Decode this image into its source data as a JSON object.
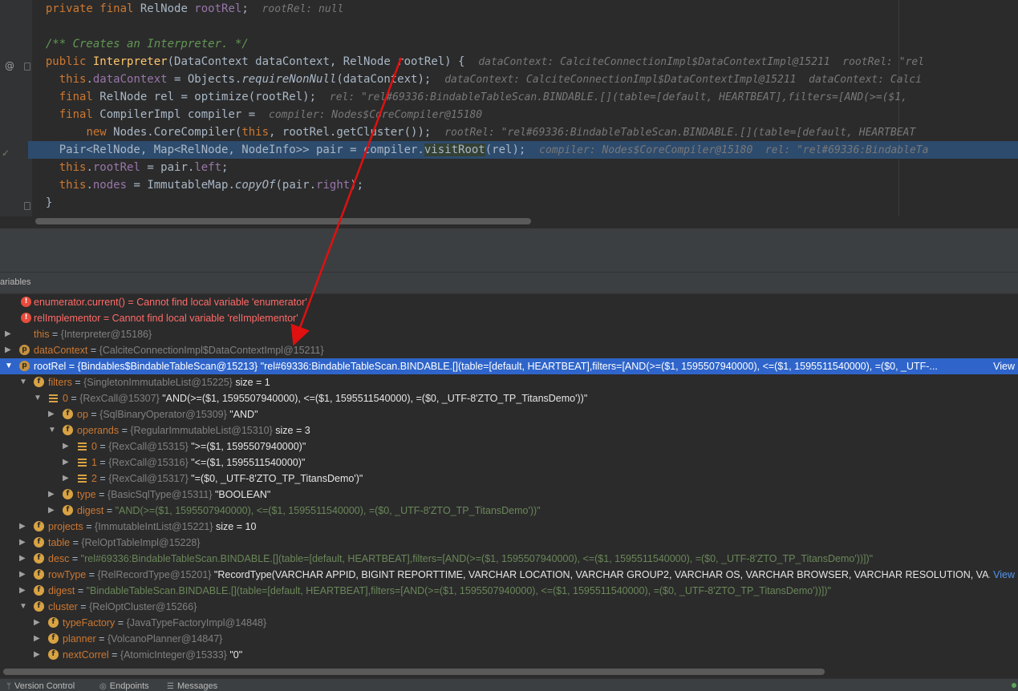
{
  "editor": {
    "lines": [
      {
        "kind": "field",
        "text": "private final RelNode rootRel;",
        "hint": "rootRel: null"
      },
      {
        "kind": "blank"
      },
      {
        "kind": "comment",
        "text": "/** Creates an Interpreter. */"
      },
      {
        "kind": "ctor",
        "hint": "dataContext: CalciteConnectionImpl$DataContextImpl@15211  rootRel: \"rel"
      },
      {
        "kind": "assign1",
        "hint": "dataContext: CalciteConnectionImpl$DataContextImpl@15211  dataContext: Calci"
      },
      {
        "kind": "assign2",
        "hint": "rel: \"rel#69336:BindableTableScan.BINDABLE.[](table=[default, HEARTBEAT],filters=[AND(>=($1,"
      },
      {
        "kind": "assign3",
        "hint": "compiler: Nodes$CoreCompiler@15180"
      },
      {
        "kind": "assign4",
        "hint": "rootRel: \"rel#69336:BindableTableScan.BINDABLE.[](table=[default, HEARTBEAT"
      },
      {
        "kind": "assign5",
        "hint": "compiler: Nodes$CoreCompiler@15180  rel: \"rel#69336:BindableTa"
      },
      {
        "kind": "assign6"
      },
      {
        "kind": "assign7"
      },
      {
        "kind": "close",
        "text": "}"
      }
    ]
  },
  "panel": {
    "variables_label": "ariables"
  },
  "tree": {
    "rows": [
      {
        "indent": 0,
        "arrow": "",
        "icon": "err",
        "name": "enumerator.current()",
        "eq": " = ",
        "error": "Cannot find local variable 'enumerator'"
      },
      {
        "indent": 0,
        "arrow": "",
        "icon": "err",
        "name": "relImplementor",
        "eq": " = ",
        "error": "Cannot find local variable 'relImplementor'"
      },
      {
        "indent": 0,
        "arrow": "right",
        "icon": "",
        "name": "this",
        "eq": " = ",
        "ref": "{Interpreter@15186}"
      },
      {
        "indent": 0,
        "arrow": "right",
        "icon": "p",
        "name": "dataContext",
        "eq": " = ",
        "ref": "{CalciteConnectionImpl$DataContextImpl@15211}"
      },
      {
        "indent": 0,
        "arrow": "down",
        "icon": "p",
        "name": "rootRel",
        "eq": " = ",
        "ref": "{Bindables$BindableTableScan@15213}",
        "val": " \"rel#69336:BindableTableScan.BINDABLE.[](table=[default, HEARTBEAT],filters=[AND(>=($1, 1595507940000), <=($1, 1595511540000), =($0, _UTF-...",
        "view": "View",
        "selected": true
      },
      {
        "indent": 1,
        "arrow": "down",
        "icon": "f",
        "name": "filters",
        "eq": " = ",
        "ref": "{SingletonImmutableList@15225}",
        "val": "  size = 1"
      },
      {
        "indent": 2,
        "arrow": "down",
        "icon": "arr",
        "name": "0",
        "eq": " = ",
        "ref": "{RexCall@15307}",
        "val": " \"AND(>=($1, 1595507940000), <=($1, 1595511540000), =($0, _UTF-8'ZTO_TP_TitansDemo'))\""
      },
      {
        "indent": 3,
        "arrow": "right",
        "icon": "f",
        "name": "op",
        "eq": " = ",
        "ref": "{SqlBinaryOperator@15309}",
        "val": " \"AND\""
      },
      {
        "indent": 3,
        "arrow": "down",
        "icon": "f",
        "name": "operands",
        "eq": " = ",
        "ref": "{RegularImmutableList@15310}",
        "val": "  size = 3"
      },
      {
        "indent": 4,
        "arrow": "right",
        "icon": "arr",
        "name": "0",
        "eq": " = ",
        "ref": "{RexCall@15315}",
        "val": " \">=($1, 1595507940000)\""
      },
      {
        "indent": 4,
        "arrow": "right",
        "icon": "arr",
        "name": "1",
        "eq": " = ",
        "ref": "{RexCall@15316}",
        "val": " \"<=($1, 1595511540000)\""
      },
      {
        "indent": 4,
        "arrow": "right",
        "icon": "arr",
        "name": "2",
        "eq": " = ",
        "ref": "{RexCall@15317}",
        "val": " \"=($0, _UTF-8'ZTO_TP_TitansDemo')\""
      },
      {
        "indent": 3,
        "arrow": "right",
        "icon": "f",
        "name": "type",
        "eq": " = ",
        "ref": "{BasicSqlType@15311}",
        "val": " \"BOOLEAN\""
      },
      {
        "indent": 3,
        "arrow": "right",
        "icon": "f",
        "name": "digest",
        "eq": " = ",
        "str": "\"AND(>=($1, 1595507940000), <=($1, 1595511540000), =($0, _UTF-8'ZTO_TP_TitansDemo'))\""
      },
      {
        "indent": 1,
        "arrow": "right",
        "icon": "f",
        "name": "projects",
        "eq": " = ",
        "ref": "{ImmutableIntList@15221}",
        "val": "  size = 10"
      },
      {
        "indent": 1,
        "arrow": "right",
        "icon": "f",
        "name": "table",
        "eq": " = ",
        "ref": "{RelOptTableImpl@15228}"
      },
      {
        "indent": 1,
        "arrow": "right",
        "icon": "f",
        "name": "desc",
        "eq": " = ",
        "str": "\"rel#69336:BindableTableScan.BINDABLE.[](table=[default, HEARTBEAT],filters=[AND(>=($1, 1595507940000), <=($1, 1595511540000), =($0, _UTF-8'ZTO_TP_TitansDemo'))])\""
      },
      {
        "indent": 1,
        "arrow": "right",
        "icon": "f",
        "name": "rowType",
        "eq": " = ",
        "ref": "{RelRecordType@15201}",
        "val": " \"RecordType(VARCHAR APPID, BIGINT REPORTTIME, VARCHAR LOCATION, VARCHAR GROUP2, VARCHAR OS, VARCHAR BROWSER, VARCHAR RESOLUTION, VA...",
        "view": "View"
      },
      {
        "indent": 1,
        "arrow": "right",
        "icon": "f",
        "name": "digest",
        "eq": " = ",
        "str": "\"BindableTableScan.BINDABLE.[](table=[default, HEARTBEAT],filters=[AND(>=($1, 1595507940000), <=($1, 1595511540000), =($0, _UTF-8'ZTO_TP_TitansDemo'))])\""
      },
      {
        "indent": 1,
        "arrow": "down",
        "icon": "f",
        "name": "cluster",
        "eq": " = ",
        "ref": "{RelOptCluster@15266}"
      },
      {
        "indent": 2,
        "arrow": "right",
        "icon": "f",
        "name": "typeFactory",
        "eq": " = ",
        "ref": "{JavaTypeFactoryImpl@14848}"
      },
      {
        "indent": 2,
        "arrow": "right",
        "icon": "f",
        "name": "planner",
        "eq": " = ",
        "ref": "{VolcanoPlanner@14847}"
      },
      {
        "indent": 2,
        "arrow": "right",
        "icon": "f",
        "name": "nextCorrel",
        "eq": " = ",
        "ref": "{AtomicInteger@15333}",
        "val": " \"0\""
      }
    ]
  },
  "statusbar": {
    "tabs": [
      {
        "icon": "branch-icon",
        "label": "Version Control"
      },
      {
        "icon": "endpoints-icon",
        "label": "Endpoints"
      },
      {
        "icon": "messages-icon",
        "label": "Messages"
      }
    ]
  },
  "colors": {
    "selection": "#2f65ca",
    "annotation_arrow": "#e01010",
    "current_line": "#2d4b6d"
  }
}
